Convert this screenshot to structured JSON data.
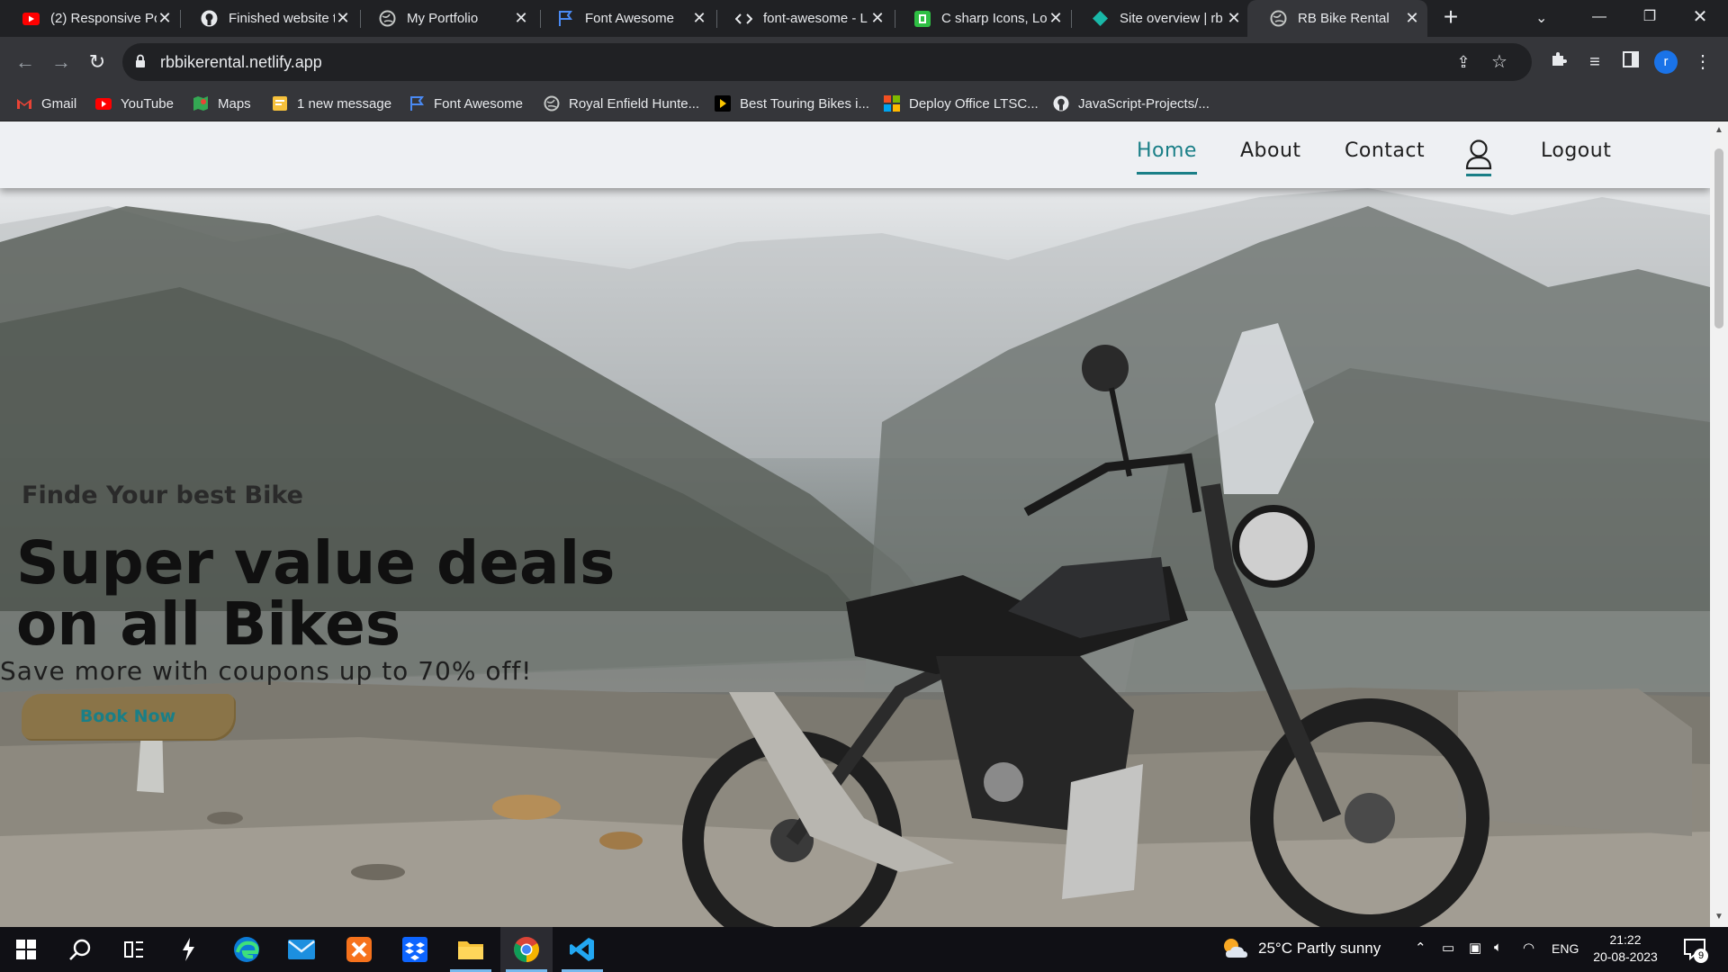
{
  "browser": {
    "tabs": [
      {
        "title": "(2) Responsive Po",
        "icon": "youtube-icon"
      },
      {
        "title": "Finished website t",
        "icon": "github-icon"
      },
      {
        "title": "My Portfolio",
        "icon": "globe-icon"
      },
      {
        "title": "Font Awesome",
        "icon": "flag-icon"
      },
      {
        "title": "font-awesome - L",
        "icon": "code-icon"
      },
      {
        "title": "C sharp Icons, Lo",
        "icon": "green-app-icon"
      },
      {
        "title": "Site overview | rb",
        "icon": "netlify-icon"
      },
      {
        "title": "RB Bike Rental",
        "icon": "globe-icon",
        "active": true
      }
    ],
    "close_glyph": "✕",
    "url": "rbbikerental.netlify.app",
    "profile_initial": "r",
    "bookmarks": [
      {
        "label": "Gmail",
        "icon": "gmail-icon"
      },
      {
        "label": "YouTube",
        "icon": "youtube-icon"
      },
      {
        "label": "Maps",
        "icon": "maps-icon"
      },
      {
        "label": "1 new message",
        "icon": "message-icon"
      },
      {
        "label": "Font Awesome",
        "icon": "flag-icon"
      },
      {
        "label": "Royal Enfield Hunte...",
        "icon": "globe-icon"
      },
      {
        "label": "Best Touring Bikes i...",
        "icon": "play-icon"
      },
      {
        "label": "Deploy Office LTSC...",
        "icon": "microsoft-icon"
      },
      {
        "label": "JavaScript-Projects/...",
        "icon": "github-icon"
      }
    ],
    "accent": "#1a73e8"
  },
  "site": {
    "nav": {
      "home": "Home",
      "about": "About",
      "contact": "Contact",
      "logout": "Logout"
    },
    "hero": {
      "kicker": "Finde Your best Bike",
      "title_line1": "Super value deals",
      "title_line2": "on all Bikes",
      "subtitle": "Save more with coupons up to 70% off!",
      "cta": "Book Now"
    },
    "colors": {
      "accent": "#1a7f87",
      "button_bg": "#8a7448",
      "nav_bg": "#eef0f3"
    }
  },
  "taskbar": {
    "apps": [
      "windows-start-icon",
      "search-icon",
      "task-view-icon",
      "winget-icon",
      "edge-icon",
      "mail-icon",
      "xampp-icon",
      "dropbox-icon",
      "file-explorer-icon",
      "chrome-icon",
      "vscode-icon"
    ],
    "weather": "25°C  Partly sunny",
    "language": "ENG",
    "time": "21:22",
    "date": "20-08-2023",
    "notifications": "9"
  }
}
